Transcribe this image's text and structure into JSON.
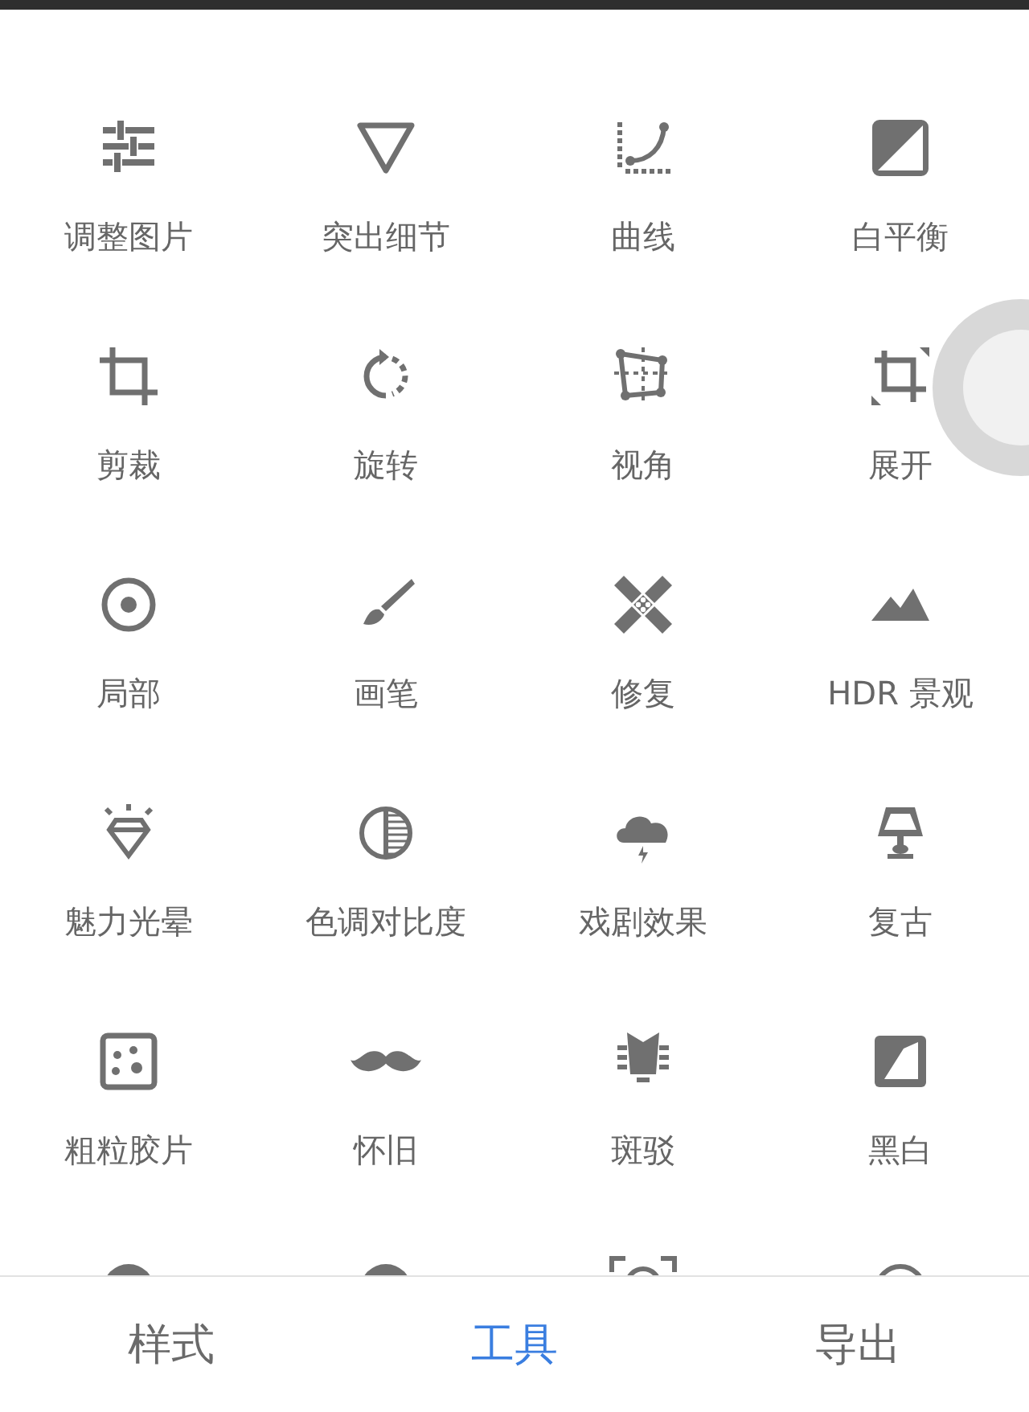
{
  "tools": [
    {
      "label": "调整图片"
    },
    {
      "label": "突出细节"
    },
    {
      "label": "曲线"
    },
    {
      "label": "白平衡"
    },
    {
      "label": "剪裁"
    },
    {
      "label": "旋转"
    },
    {
      "label": "视角"
    },
    {
      "label": "展开"
    },
    {
      "label": "局部"
    },
    {
      "label": "画笔"
    },
    {
      "label": "修复"
    },
    {
      "label": "HDR 景观"
    },
    {
      "label": "魅力光晕"
    },
    {
      "label": "色调对比度"
    },
    {
      "label": "戏剧效果"
    },
    {
      "label": "复古"
    },
    {
      "label": "粗粒胶片"
    },
    {
      "label": "怀旧"
    },
    {
      "label": "斑驳"
    },
    {
      "label": "黑白"
    }
  ],
  "tabs": [
    {
      "label": "样式",
      "selected": false
    },
    {
      "label": "工具",
      "selected": true
    },
    {
      "label": "导出",
      "selected": false
    }
  ]
}
